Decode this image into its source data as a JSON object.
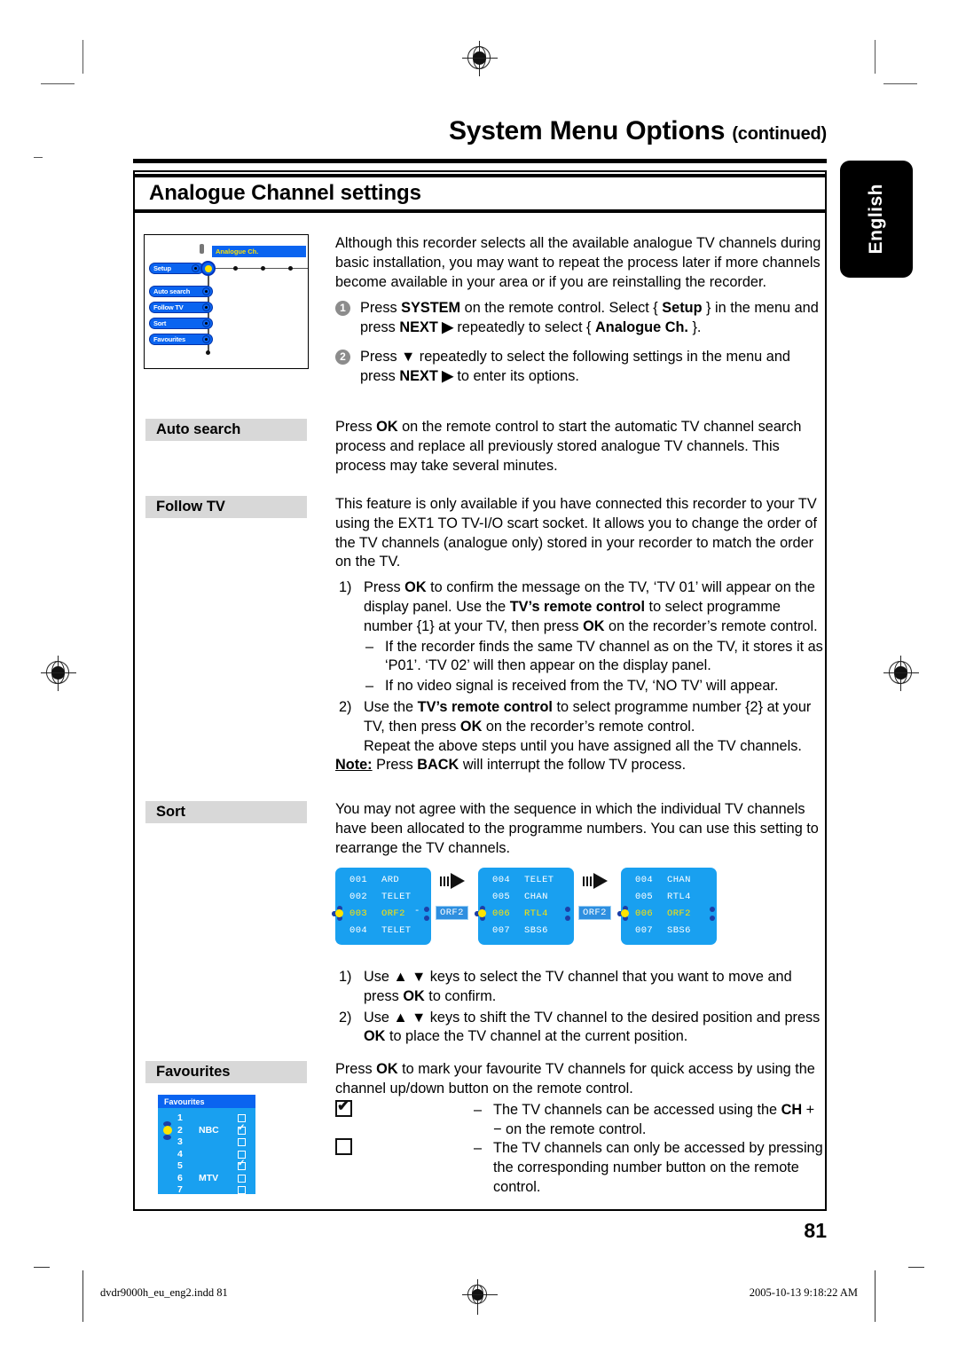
{
  "header": {
    "title": "System Menu Options",
    "title_suffix": "(continued)",
    "lang_tab": "English"
  },
  "section": {
    "title": "Analogue Channel settings"
  },
  "menu_diagram": {
    "title_node": "Analogue Ch.",
    "root": "Setup",
    "items": [
      "Auto search",
      "Follow TV",
      "Sort",
      "Favourites"
    ]
  },
  "intro": {
    "paragraph": "Although this recorder selects all the available analogue TV channels during basic installation, you may want to repeat the process later if more channels become available in your area or if you are reinstalling the recorder.",
    "steps": [
      {
        "num": "1",
        "parts": [
          {
            "t": "Press ",
            "b": false
          },
          {
            "t": "SYSTEM",
            "b": true
          },
          {
            "t": " on the remote control. Select { ",
            "b": false
          },
          {
            "t": "Setup",
            "b": true
          },
          {
            "t": " } in the menu and press ",
            "b": false
          },
          {
            "t": "NEXT ▶",
            "b": true
          },
          {
            "t": " repeatedly to select { ",
            "b": false
          },
          {
            "t": "Analogue Ch.",
            "b": true
          },
          {
            "t": " }.",
            "b": false
          }
        ]
      },
      {
        "num": "2",
        "parts": [
          {
            "t": "Press ▼ repeatedly to select the following settings in the menu and press ",
            "b": false
          },
          {
            "t": "NEXT ▶",
            "b": true
          },
          {
            "t": " to enter its options.",
            "b": false
          }
        ]
      }
    ]
  },
  "auto_search": {
    "label": "Auto search",
    "parts": [
      {
        "t": "Press ",
        "b": false
      },
      {
        "t": "OK",
        "b": true
      },
      {
        "t": " on the remote control to start the automatic TV channel search process and replace all previously stored analogue TV channels. This process may take several minutes.",
        "b": false
      }
    ]
  },
  "follow_tv": {
    "label": "Follow TV",
    "intro": "This feature is only available if you have connected this recorder to your TV using the EXT1 TO TV-I/O scart socket. It allows you to change the order of the TV channels (analogue only) stored in your recorder to match the order on the TV.",
    "step1_num": "1)",
    "step1_parts": [
      {
        "t": "Press ",
        "b": false
      },
      {
        "t": "OK",
        "b": true
      },
      {
        "t": " to confirm the message on the TV, ‘TV 01’ will appear on the display panel. Use the ",
        "b": false
      },
      {
        "t": "TV’s remote control",
        "b": true
      },
      {
        "t": " to select programme number {1} at your TV, then press ",
        "b": false
      },
      {
        "t": "OK",
        "b": true
      },
      {
        "t": " on the recorder’s remote control.",
        "b": false
      }
    ],
    "dashes": [
      "If the recorder finds the same TV channel as on the TV, it stores it as ‘P01’. ‘TV 02’ will then appear on the display panel.",
      "If no video signal is received from the TV, ‘NO TV’ will appear."
    ],
    "step2_num": "2)",
    "step2_parts": [
      {
        "t": "Use the ",
        "b": false
      },
      {
        "t": "TV’s remote control",
        "b": true
      },
      {
        "t": " to select programme number {2} at your TV, then press ",
        "b": false
      },
      {
        "t": "OK",
        "b": true
      },
      {
        "t": " on the recorder’s remote control.",
        "b": false
      }
    ],
    "repeat_line": "Repeat the above steps until you have assigned all the TV channels.",
    "note_label": "Note:",
    "note_parts": [
      {
        "t": " Press ",
        "b": false
      },
      {
        "t": "BACK",
        "b": true
      },
      {
        "t": " will interrupt the follow TV process.",
        "b": false
      }
    ]
  },
  "sort": {
    "label": "Sort",
    "intro": "You may not agree with the sequence in which the individual TV channels have been allocated to the programme numbers. You can use this setting to rearrange the TV channels.",
    "panels": [
      {
        "rows": [
          {
            "num": "001",
            "name": "ARD",
            "selected": false
          },
          {
            "num": "002",
            "name": "TELET",
            "selected": false
          },
          {
            "num": "003",
            "name": "ORF2",
            "selected": true
          },
          {
            "num": "004",
            "name": "TELET",
            "selected": false
          }
        ],
        "tag": "ORF2",
        "tag_dash": true
      },
      {
        "rows": [
          {
            "num": "004",
            "name": "TELET",
            "selected": false
          },
          {
            "num": "005",
            "name": "CHAN",
            "selected": false
          },
          {
            "num": "006",
            "name": "RTL4",
            "selected": true
          },
          {
            "num": "007",
            "name": "SBS6",
            "selected": false
          }
        ],
        "tag": "ORF2",
        "tag_dash": false
      },
      {
        "rows": [
          {
            "num": "004",
            "name": "CHAN",
            "selected": false
          },
          {
            "num": "005",
            "name": "RTL4",
            "selected": false
          },
          {
            "num": "006",
            "name": "ORF2",
            "selected": true
          },
          {
            "num": "007",
            "name": "SBS6",
            "selected": false
          }
        ],
        "tag": "",
        "tag_dash": false
      }
    ],
    "step1_num": "1)",
    "step1_parts": [
      {
        "t": "Use ▲ ▼ keys to select the TV channel that you want to move and press ",
        "b": false
      },
      {
        "t": "OK",
        "b": true
      },
      {
        "t": " to confirm.",
        "b": false
      }
    ],
    "step2_num": "2)",
    "step2_parts": [
      {
        "t": "Use ▲ ▼ keys to shift the TV channel to the desired position and press ",
        "b": false
      },
      {
        "t": "OK",
        "b": true
      },
      {
        "t": " to place the TV channel at the current position.",
        "b": false
      }
    ]
  },
  "favourites": {
    "label": "Favourites",
    "intro_parts": [
      {
        "t": "Press ",
        "b": false
      },
      {
        "t": "OK",
        "b": true
      },
      {
        "t": " to mark your favourite TV channels for quick access by using the channel up/down button on the remote control.",
        "b": false
      }
    ],
    "screen_title": "Favourites",
    "rows": [
      {
        "n": "1",
        "name": "",
        "checked": false,
        "selected": false
      },
      {
        "n": "2",
        "name": "NBC",
        "checked": true,
        "selected": true
      },
      {
        "n": "3",
        "name": "",
        "checked": false,
        "selected": false
      },
      {
        "n": "4",
        "name": "",
        "checked": false,
        "selected": false
      },
      {
        "n": "5",
        "name": "",
        "checked": true,
        "selected": false
      },
      {
        "n": "6",
        "name": "MTV",
        "checked": false,
        "selected": false
      },
      {
        "n": "7",
        "name": "",
        "checked": false,
        "selected": false
      }
    ],
    "checked_desc_parts": [
      {
        "t": "The TV channels can be accessed using the ",
        "b": false
      },
      {
        "t": "CH",
        "b": true
      },
      {
        "t": " + − on the remote control.",
        "b": false
      }
    ],
    "unchecked_desc": "The TV channels can only be accessed by pressing the corresponding number button on the remote control."
  },
  "footer": {
    "page_number": "81",
    "file_name": "dvdr9000h_eu_eng2.indd  81",
    "timestamp": "2005-10-13  9:18:22 AM"
  }
}
